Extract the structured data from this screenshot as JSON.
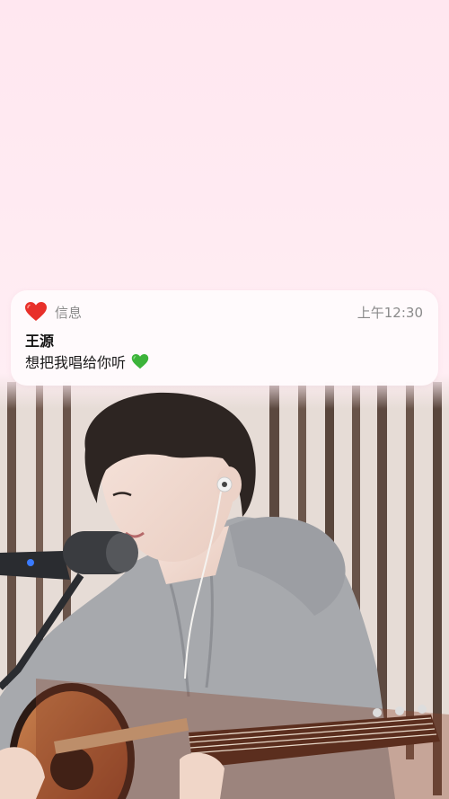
{
  "notification": {
    "app_icon": "red-heart-icon",
    "app_name": "信息",
    "time": "上午12:30",
    "sender": "王源",
    "message": "想把我唱给你听",
    "message_emoji": "green-heart-icon"
  },
  "colors": {
    "background_pink": "#ffe9f1",
    "notification_bg": "#fffafc",
    "red_heart": "#e8302a",
    "green_heart": "#3cb33a",
    "meta_text": "#8a8a8a"
  },
  "photo": {
    "subject": "singer-playing-acoustic-guitar"
  }
}
